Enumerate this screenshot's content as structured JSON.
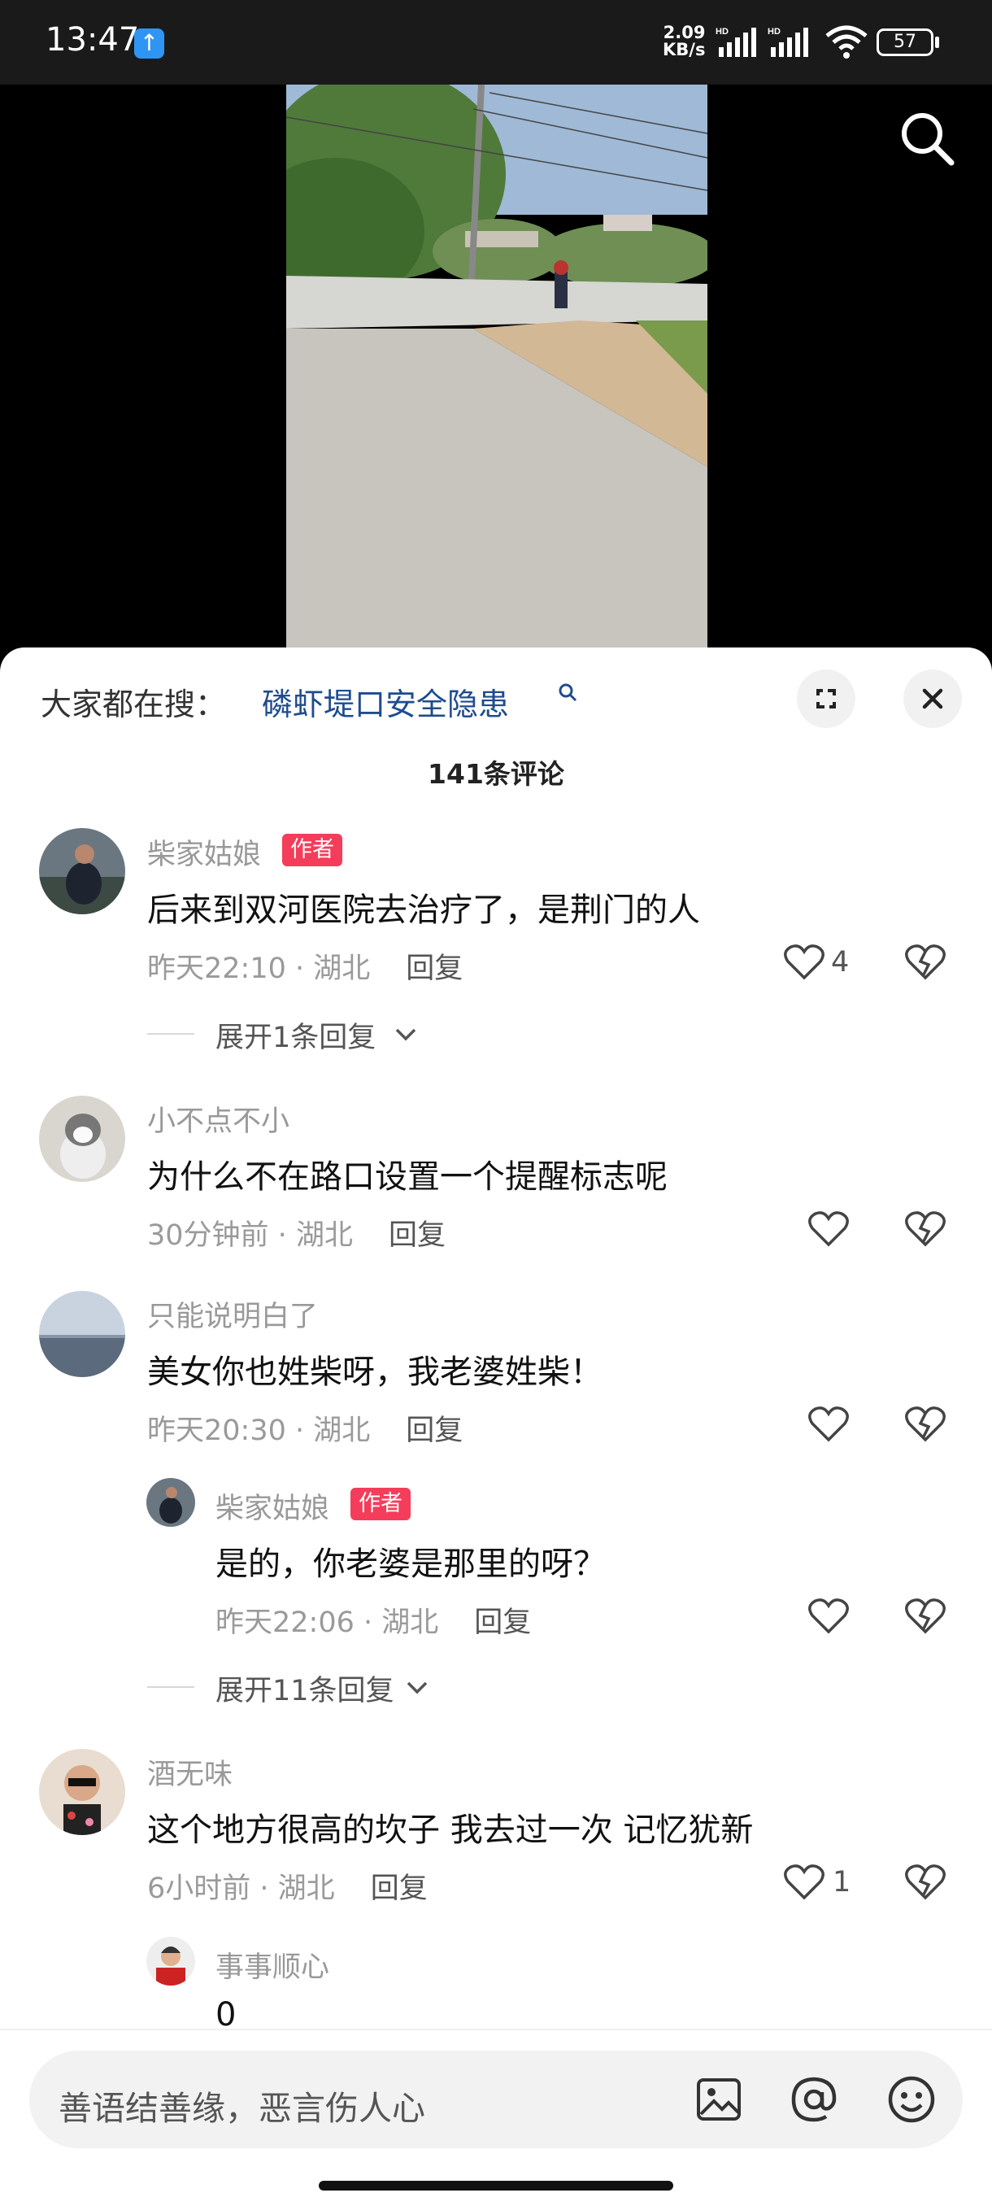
{
  "status_bar": {
    "time": "13:47",
    "net_speed_value": "2.09",
    "net_speed_unit": "KB/s",
    "hd_label": "HD",
    "battery": "57"
  },
  "hot_search": {
    "label": "大家都在搜：",
    "query": "磷虾堤口安全隐患"
  },
  "comments_count": "141条评论",
  "comments": [
    {
      "author": "柴家姑娘",
      "badge": "作者",
      "text": "后来到双河医院去治疗了，是荆门的人",
      "time": "昨天22:10",
      "location": "湖北",
      "reply_label": "回复",
      "likes": "4",
      "expand": "展开1条回复"
    },
    {
      "author": "小不点不小",
      "text": "为什么不在路口设置一个提醒标志呢",
      "time": "30分钟前",
      "location": "湖北",
      "reply_label": "回复"
    },
    {
      "author": "只能说明白了",
      "text": "美女你也姓柴呀，我老婆姓柴！",
      "time": "昨天20:30",
      "location": "湖北",
      "reply_label": "回复",
      "replies": [
        {
          "author": "柴家姑娘",
          "badge": "作者",
          "text": "是的，你老婆是那里的呀？",
          "time": "昨天22:06",
          "location": "湖北",
          "reply_label": "回复"
        }
      ],
      "expand": "展开11条回复"
    },
    {
      "author": "酒无味",
      "text": "这个地方很高的坎子  我去过一次  记忆犹新",
      "time": "6小时前",
      "location": "湖北",
      "reply_label": "回复",
      "likes": "1",
      "replies": [
        {
          "author": "事事顺心",
          "text": "0"
        }
      ]
    }
  ],
  "input": {
    "placeholder": "善语结善缘，恶言伤人心"
  },
  "colors": {
    "link": "#1f4c8e",
    "badge": "#f43d5a",
    "upload": "#2f95f4"
  }
}
